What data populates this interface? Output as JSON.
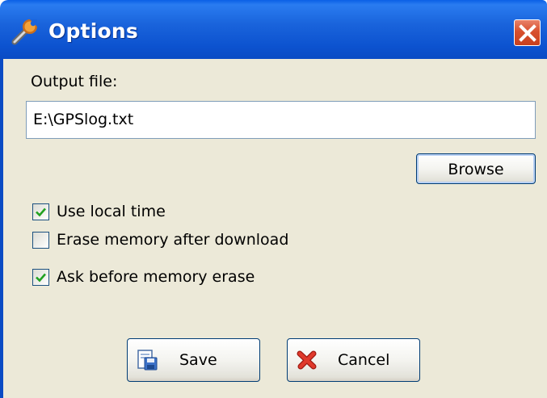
{
  "window": {
    "title": "Options",
    "title_icon": "wrench-icon",
    "close_icon": "close-icon"
  },
  "output": {
    "label": "Output file:",
    "value": "E:\\GPSlog.txt"
  },
  "browse_button": {
    "label": "Browse"
  },
  "options": [
    {
      "label": "Use local time",
      "checked": true
    },
    {
      "label": "Erase memory after download",
      "checked": false
    },
    {
      "label": "Ask before memory erase",
      "checked": true
    }
  ],
  "save_button": {
    "label": "Save",
    "icon": "save-disk-icon"
  },
  "cancel_button": {
    "label": "Cancel",
    "icon": "red-x-icon"
  },
  "colors": {
    "titlebar": "#0a52cf",
    "client_bg": "#ece9d8",
    "close_button": "#d8502e",
    "check_mark": "#21a121"
  }
}
